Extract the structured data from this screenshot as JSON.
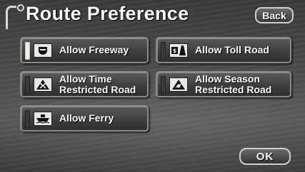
{
  "header": {
    "title": "Route Preference",
    "back_label": "Back"
  },
  "options": [
    {
      "label_line1": "Allow Freeway",
      "label_line2": "",
      "icon": "freeway-shield-icon",
      "selected": true
    },
    {
      "label_line1": "Allow Toll Road",
      "label_line2": "",
      "icon": "toll-booth-icon",
      "selected": false
    },
    {
      "label_line1": "Allow Time",
      "label_line2": "Restricted Road",
      "icon": "time-restricted-road-icon",
      "selected": false
    },
    {
      "label_line1": "Allow Season",
      "label_line2": "Restricted Road",
      "icon": "season-restricted-road-icon",
      "selected": false
    },
    {
      "label_line1": "Allow Ferry",
      "label_line2": "",
      "icon": "ferry-icon",
      "selected": false
    }
  ],
  "footer": {
    "ok_label": "OK"
  },
  "colors": {
    "indicator_on": "#f0f0e6",
    "button_border": "#8a8a8a",
    "text": "#ffffff"
  }
}
